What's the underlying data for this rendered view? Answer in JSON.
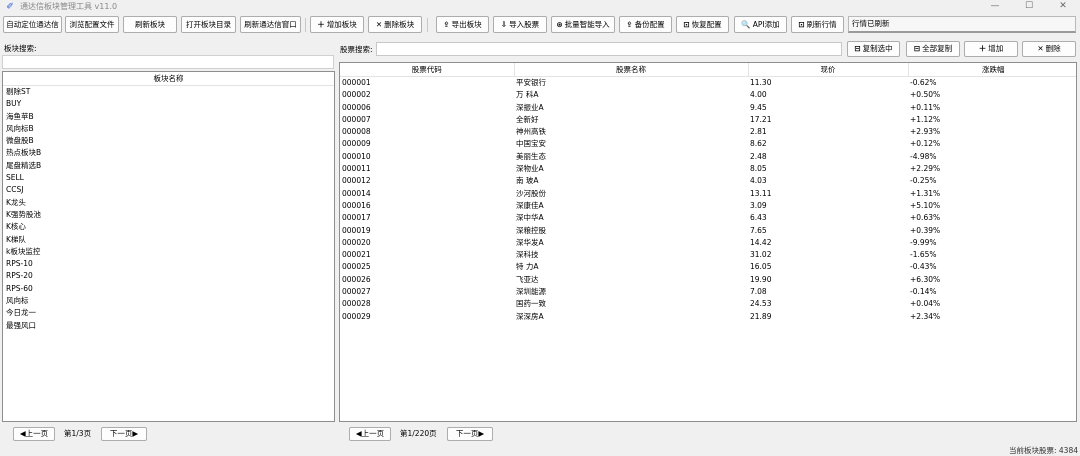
{
  "window": {
    "title": "通达信板块管理工具 v11.0",
    "controls": [
      "—",
      "☐",
      "✕"
    ]
  },
  "toolbar": {
    "buttons": [
      {
        "label": "自动定位通达信",
        "icon": ""
      },
      {
        "label": "浏览配置文件",
        "icon": ""
      },
      {
        "label": "刷新板块",
        "icon": ""
      },
      {
        "label": "打开板块目录",
        "icon": ""
      },
      {
        "label": "刷新通达信窗口",
        "icon": ""
      },
      {
        "label": "增加板块",
        "icon": "＋"
      },
      {
        "label": "删除板块",
        "icon": "✕"
      },
      {
        "label": "导出板块",
        "icon": "⇪"
      },
      {
        "label": "导入股票",
        "icon": "⇩"
      },
      {
        "label": "批量智能导入",
        "icon": "⊛"
      },
      {
        "label": "备份配置",
        "icon": "⇪"
      },
      {
        "label": "恢复配置",
        "icon": "⊡"
      },
      {
        "label": "API添加",
        "icon": "🔍"
      },
      {
        "label": "刷新行情",
        "icon": "⊡"
      }
    ],
    "status": "行情已刷新"
  },
  "left": {
    "search_label": "板块搜索:",
    "search_value": "",
    "column_header": "板块名称",
    "items": [
      "剔除ST",
      "BUY",
      "海鱼苹B",
      "风向标B",
      "微盘股B",
      "热点板块B",
      "尾盘精选B",
      "SELL",
      "CCSJ",
      "K龙头",
      "K强势股池",
      "K核心",
      "K梯队",
      "k板块监控",
      "RPS-10",
      "RPS-20",
      "RPS-60",
      "风向标",
      "今日龙一",
      "最强风口"
    ],
    "pager": {
      "prev": "◀上一页",
      "info": "第1/3页",
      "next": "下一页▶"
    }
  },
  "right": {
    "search_label": "股票搜索:",
    "search_value": "",
    "actions": [
      {
        "label": "复制选中",
        "icon": "⊟"
      },
      {
        "label": "全部复制",
        "icon": "⊟"
      },
      {
        "label": "增加",
        "icon": "＋"
      },
      {
        "label": "删除",
        "icon": "✕"
      }
    ],
    "columns": [
      "股票代码",
      "股票名称",
      "现价",
      "涨跌幅"
    ],
    "rows": [
      [
        "000001",
        "平安银行",
        "11.30",
        "-0.62%"
      ],
      [
        "000002",
        "万 科A",
        "4.00",
        "+0.50%"
      ],
      [
        "000006",
        "深振业A",
        "9.45",
        "+0.11%"
      ],
      [
        "000007",
        "全新好",
        "17.21",
        "+1.12%"
      ],
      [
        "000008",
        "神州高铁",
        "2.81",
        "+2.93%"
      ],
      [
        "000009",
        "中国宝安",
        "8.62",
        "+0.12%"
      ],
      [
        "000010",
        "美丽生态",
        "2.48",
        "-4.98%"
      ],
      [
        "000011",
        "深物业A",
        "8.05",
        "+2.29%"
      ],
      [
        "000012",
        "南 玻A",
        "4.03",
        "-0.25%"
      ],
      [
        "000014",
        "沙河股份",
        "13.11",
        "+1.31%"
      ],
      [
        "000016",
        "深康佳A",
        "3.09",
        "+5.10%"
      ],
      [
        "000017",
        "深中华A",
        "6.43",
        "+0.63%"
      ],
      [
        "000019",
        "深粮控股",
        "7.65",
        "+0.39%"
      ],
      [
        "000020",
        "深华发A",
        "14.42",
        "-9.99%"
      ],
      [
        "000021",
        "深科技",
        "31.02",
        "-1.65%"
      ],
      [
        "000025",
        "特 力A",
        "16.05",
        "-0.43%"
      ],
      [
        "000026",
        "飞亚达",
        "19.90",
        "+6.30%"
      ],
      [
        "000027",
        "深圳能源",
        "7.08",
        "-0.14%"
      ],
      [
        "000028",
        "国药一致",
        "24.53",
        "+0.04%"
      ],
      [
        "000029",
        "深深房A",
        "21.89",
        "+2.34%"
      ]
    ],
    "pager": {
      "prev": "◀上一页",
      "info": "第1/220页",
      "next": "下一页▶"
    }
  },
  "footer": {
    "count_text": "当前板块股票: 4384"
  }
}
